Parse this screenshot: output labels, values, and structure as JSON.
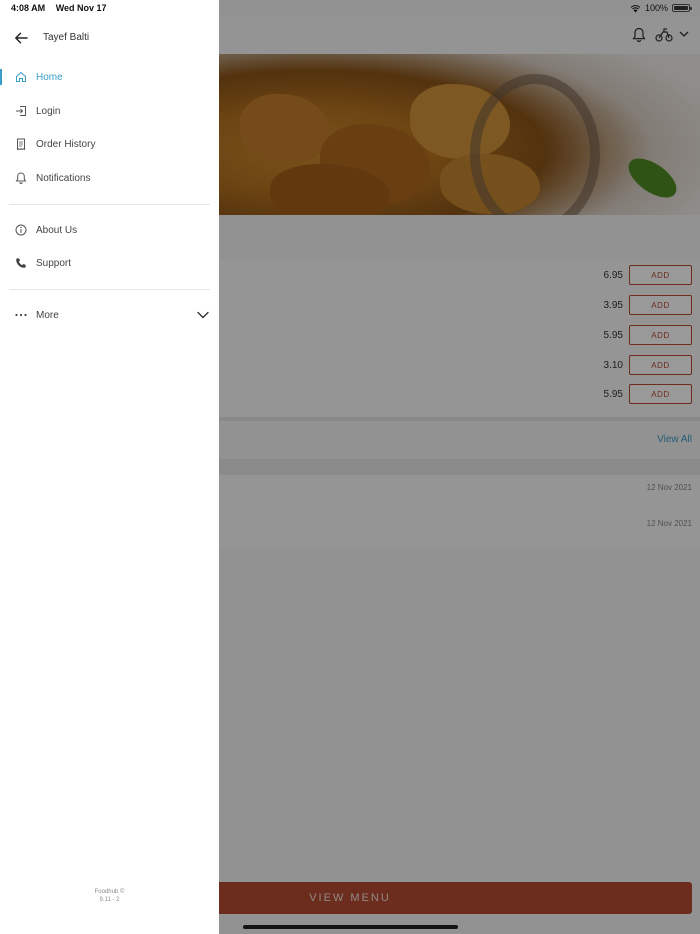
{
  "status_bar": {
    "time": "4:08 AM",
    "date": "Wed Nov 17",
    "battery": "100%",
    "battery_level": 1.0
  },
  "drawer": {
    "store_name": "Tayef Balti",
    "nav_primary": [
      {
        "label": "Home",
        "icon": "home-icon",
        "active": true
      },
      {
        "label": "Login",
        "icon": "login-icon"
      },
      {
        "label": "Order History",
        "icon": "receipt-icon"
      },
      {
        "label": "Notifications",
        "icon": "bell-icon"
      }
    ],
    "nav_secondary": [
      {
        "label": "About Us",
        "icon": "info-icon"
      },
      {
        "label": "Support",
        "icon": "phone-icon"
      }
    ],
    "more": {
      "label": "More",
      "icon": "ellipsis-icon"
    },
    "footer": {
      "brand": "Foodhub ©",
      "version": "9.11 - 2"
    }
  },
  "background": {
    "menu_items": [
      {
        "price": "6.95",
        "button": "ADD"
      },
      {
        "price": "3.95",
        "button": "ADD"
      },
      {
        "price": "5.95",
        "button": "ADD"
      },
      {
        "price": "3.10",
        "button": "ADD"
      },
      {
        "price": "5.95",
        "button": "ADD"
      }
    ],
    "view_all": "View All",
    "orders": [
      {
        "date": "12 Nov 2021"
      },
      {
        "date": "12 Nov 2021"
      }
    ],
    "view_menu": "VIEW MENU"
  },
  "colors": {
    "accent": "#3a9dc7",
    "brand": "#b44a32",
    "overlay": "rgba(0,0,0,0.40)"
  }
}
